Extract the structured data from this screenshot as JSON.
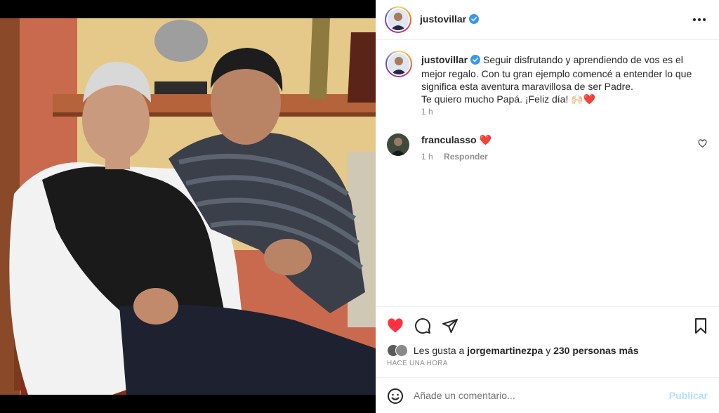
{
  "post": {
    "author": "justovillar",
    "verified": true,
    "caption_lines": [
      "Seguir disfrutando y aprendiendo de vos es el",
      "mejor regalo. Con tu gran ejemplo comencé a entender lo que",
      "significa esta aventura maravillosa de ser Padre.",
      "Te quiero mucho Papá. ¡Feliz día! 🙌🏻❤️"
    ],
    "caption_age": "1 h",
    "likes_prefix": "Les gusta a",
    "likes_user": "jorgemartinezpa",
    "likes_joiner": "y",
    "likes_rest": "230 personas más",
    "timestamp": "Hace una hora",
    "liked": true
  },
  "comments": [
    {
      "user": "franculasso",
      "text": "❤️",
      "age": "1 h",
      "reply_label": "Responder"
    }
  ],
  "composer": {
    "placeholder": "Añade un comentario...",
    "publish_label": "Publicar"
  },
  "icons": {
    "more": "more-horizontal-icon",
    "like": "heart-filled-icon",
    "comment": "comment-bubble-icon",
    "share": "paper-plane-icon",
    "save": "bookmark-icon",
    "emoji": "smiley-icon"
  },
  "colors": {
    "like_red": "#ff3040",
    "verified_blue": "#3897f0",
    "publish_disabled": "#b2dffc",
    "secondary_text": "#8e8e8e"
  }
}
